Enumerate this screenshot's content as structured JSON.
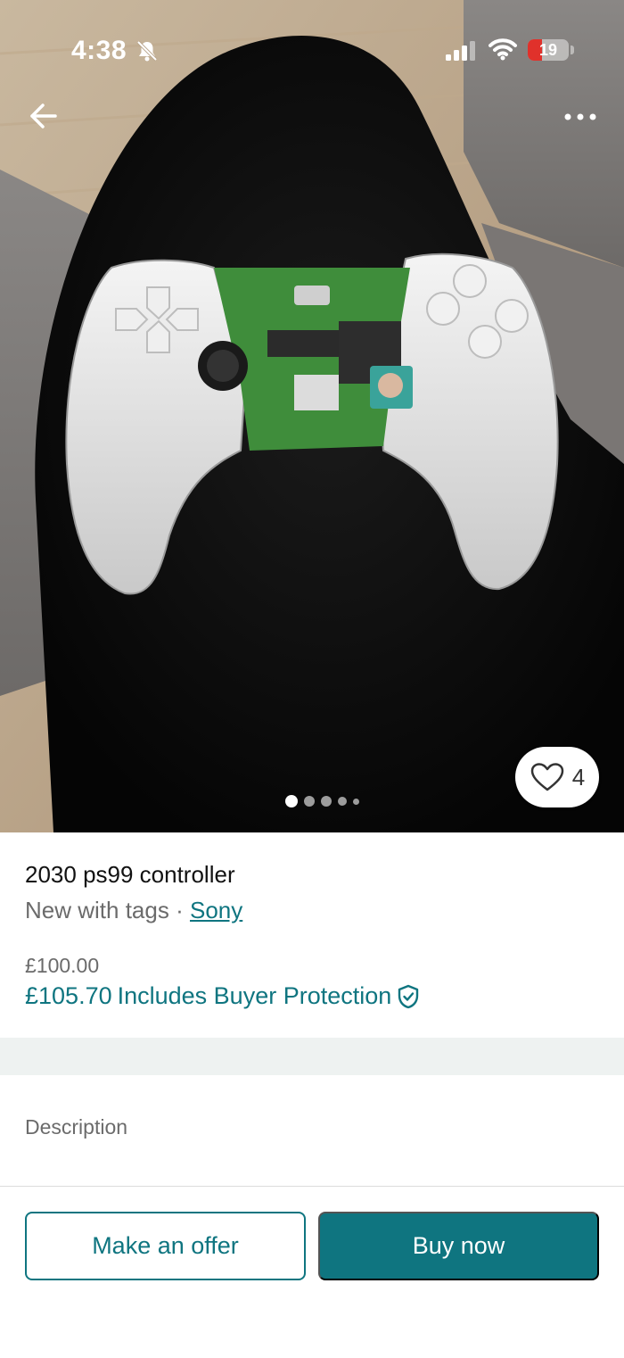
{
  "status_bar": {
    "time": "4:38",
    "battery": "19",
    "battery_level": 0.19,
    "icons": [
      "bell-off-icon",
      "signal-icon",
      "wifi-icon",
      "battery-icon"
    ]
  },
  "top_bar": {
    "back_icon": "arrow-left-icon",
    "more_icon": "more-dots-icon"
  },
  "gallery": {
    "photo_count": 5,
    "active_index": 0,
    "favourites": "4",
    "favourite_icon": "heart-outline-icon"
  },
  "listing": {
    "title": "2030 ps99 controller",
    "condition": "New with tags",
    "separator": "·",
    "brand": "Sony",
    "price": "£100.00",
    "total_price": "£105.70",
    "protection_label": "Includes Buyer Protection",
    "protection_icon": "shield-check-icon",
    "description_label": "Description"
  },
  "actions": {
    "offer_label": "Make an offer",
    "buy_label": "Buy now"
  },
  "colors": {
    "accent": "#0f7580",
    "muted_text": "#6b6b6b",
    "band": "#eef2f1",
    "battery_low": "#e0312b"
  }
}
